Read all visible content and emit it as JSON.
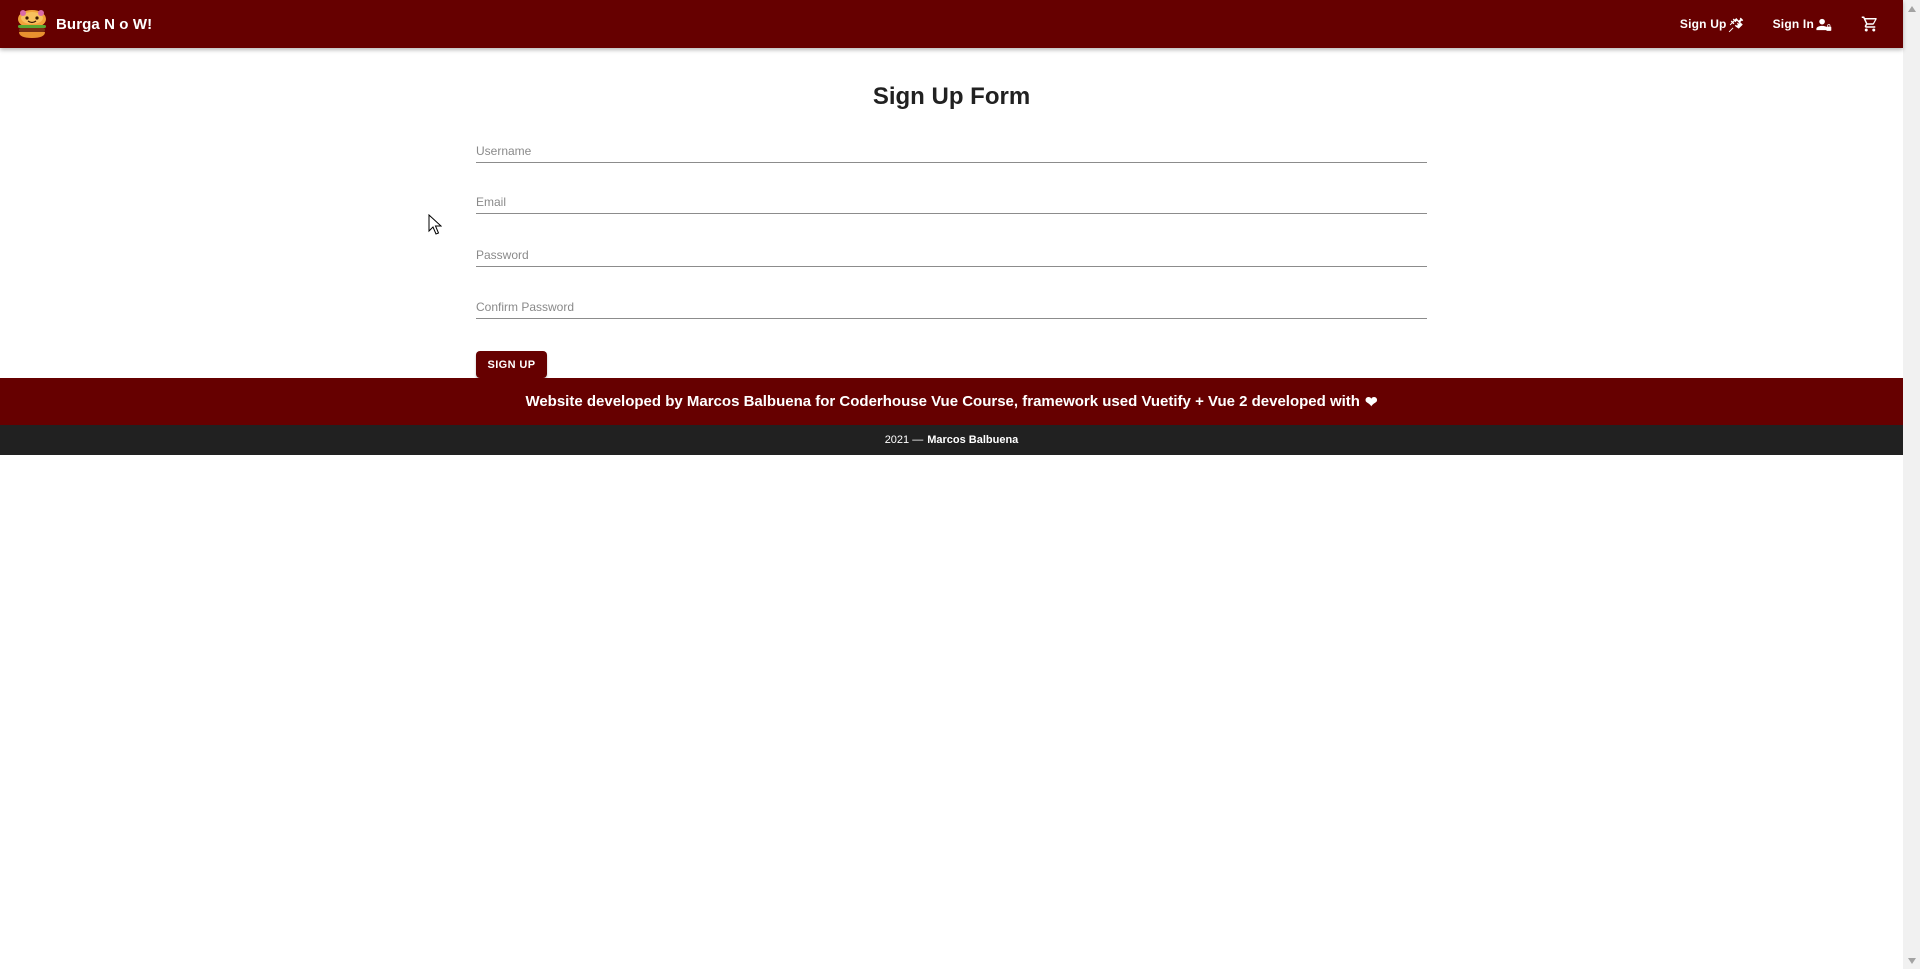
{
  "header": {
    "brand": "Burga N o W!",
    "nav": [
      {
        "label": "Sign Up",
        "icon": "syringe-icon"
      },
      {
        "label": "Sign In",
        "icon": "account-lock-icon"
      }
    ],
    "cart_icon": "cart-icon"
  },
  "form": {
    "title": "Sign Up Form",
    "fields": [
      {
        "placeholder": "Username",
        "value": ""
      },
      {
        "placeholder": "Email",
        "value": ""
      },
      {
        "placeholder": "Password",
        "value": ""
      },
      {
        "placeholder": "Confirm Password",
        "value": ""
      }
    ],
    "submit_label": "SIGN UP"
  },
  "footer": {
    "message": "Website developed by Marcos Balbuena for Coderhouse Vue Course, framework used Vuetify + Vue 2 developed with",
    "heart": "❤",
    "copyright_prefix": "2021 —",
    "author": "Marcos Balbuena"
  },
  "colors": {
    "primary": "#660000",
    "dark": "#212121",
    "background": "#ffffff"
  }
}
